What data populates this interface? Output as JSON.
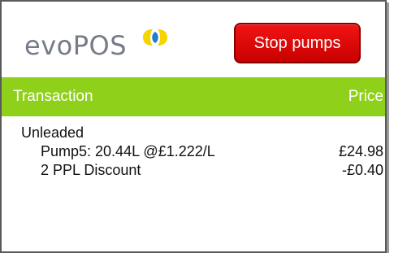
{
  "header": {
    "logo_text": "evoPOS",
    "stop_button_label": "Stop pumps"
  },
  "columns": {
    "left": "Transaction",
    "right": "Price"
  },
  "transaction": {
    "group_label": "Unleaded",
    "lines": [
      {
        "label": "Pump5: 20.44L @£1.222/L",
        "price": "£24.98"
      },
      {
        "label": "2 PPL Discount",
        "price": "-£0.40"
      }
    ]
  },
  "colors": {
    "accent_green": "#8fd11a",
    "stop_red": "#e00000",
    "logo_grey": "#767b88",
    "logo_yellow": "#f5d400"
  },
  "icons": {
    "logo_mark": "evopos-logo-mark"
  }
}
